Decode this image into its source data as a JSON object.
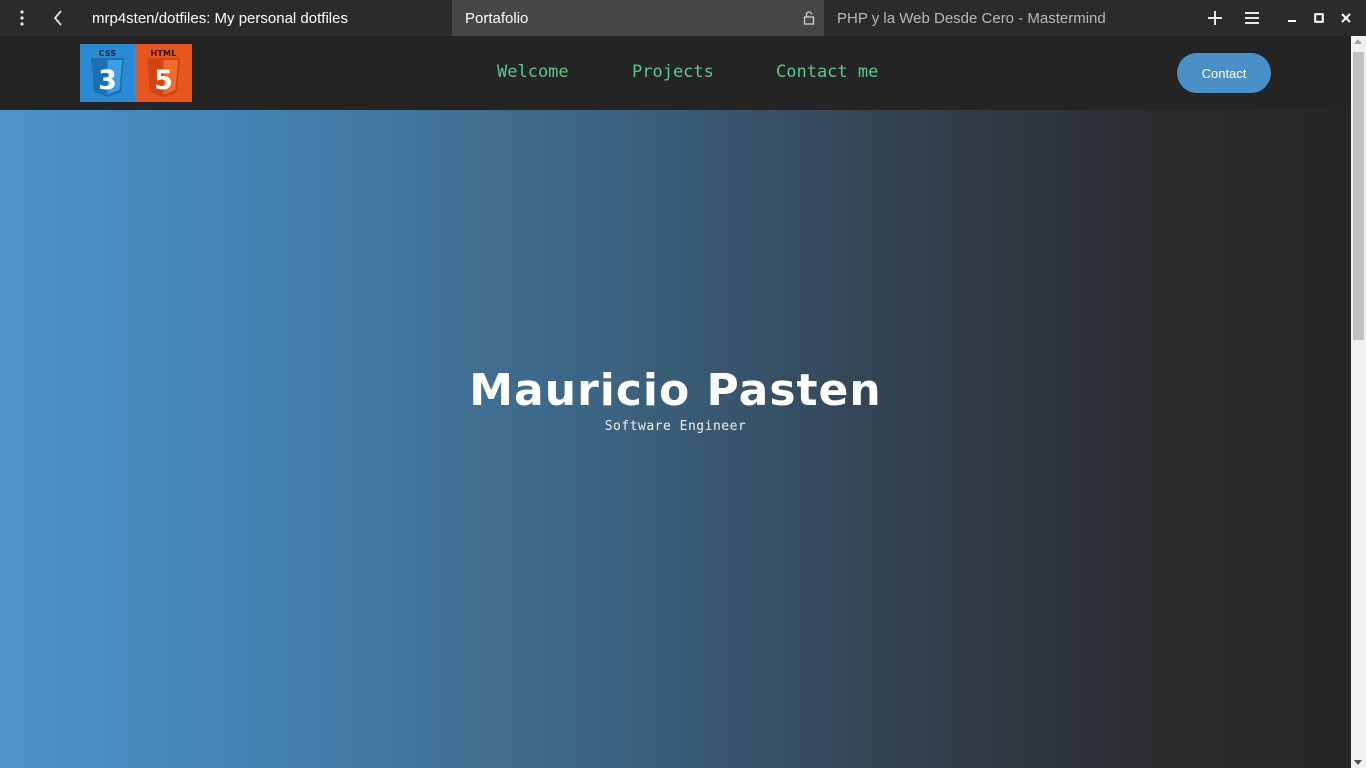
{
  "browser": {
    "tabs": [
      {
        "title": "mrp4sten/dotfiles: My personal dotfiles",
        "active": false
      },
      {
        "title": "Portafolio",
        "active": true
      },
      {
        "title": "PHP y la Web Desde Cero - Mastermind",
        "active": false
      }
    ],
    "icons": {
      "menu": "vertical-dots-icon",
      "back": "back-arrow-icon",
      "lock": "lock-icon",
      "new_tab": "plus-icon",
      "app_menu": "hamburger-icon",
      "minimize": "minimize-icon",
      "maximize": "maximize-icon",
      "close": "close-icon"
    }
  },
  "site": {
    "logo": {
      "css_label": "CSS",
      "html_label": "HTML",
      "css_digit": "3",
      "html_digit": "5"
    },
    "nav": [
      {
        "label": "Welcome"
      },
      {
        "label": "Projects"
      },
      {
        "label": "Contact me"
      }
    ],
    "contact_button": "Contact",
    "hero": {
      "title": "Mauricio Pasten",
      "subtitle": "Software Engineer"
    },
    "colors": {
      "header_bg": "#242424",
      "nav_link": "#58c987",
      "button": "#4a90c8",
      "gradient_start": "#4a95cb",
      "gradient_end": "#262626"
    }
  }
}
